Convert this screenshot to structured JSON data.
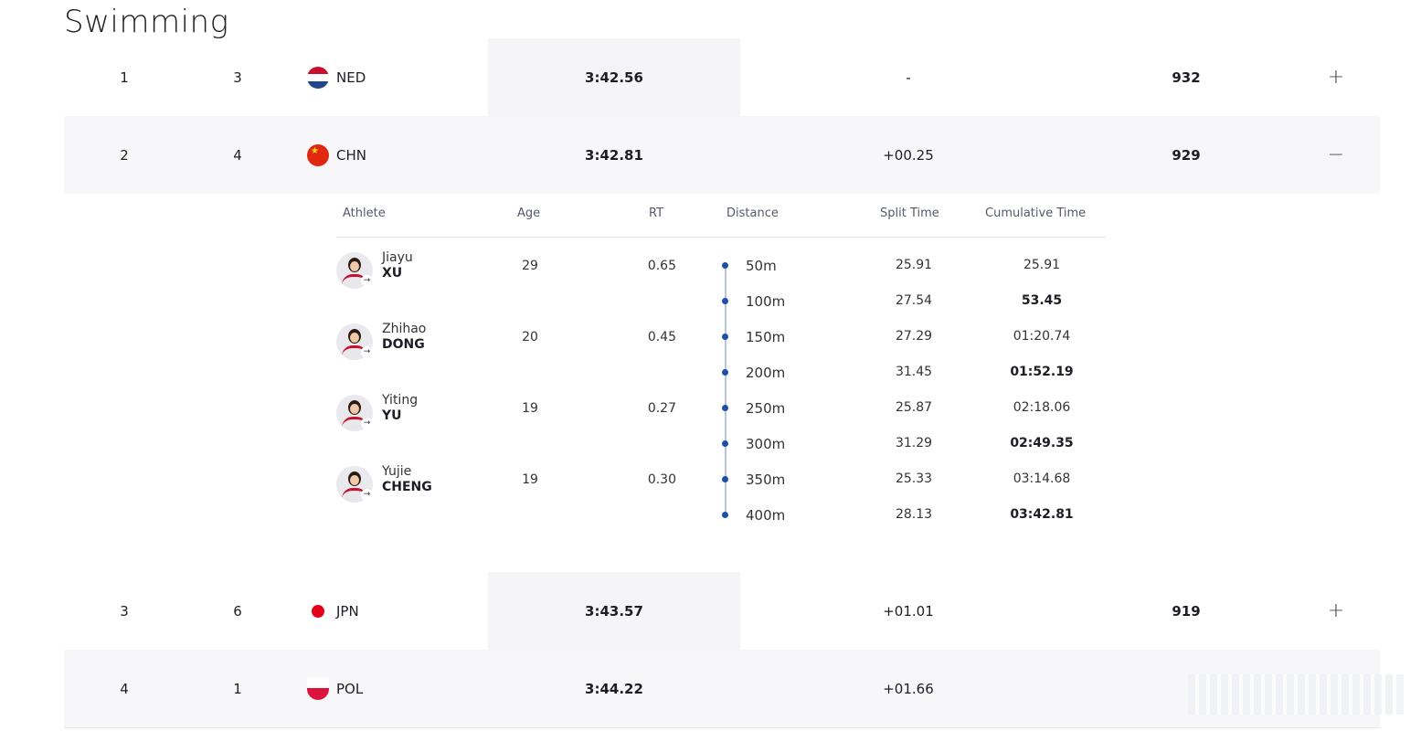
{
  "page": {
    "title": "Swimming"
  },
  "rows": [
    {
      "rank": "1",
      "lane": "3",
      "noc": "NED",
      "flag": "ned-flag-icon",
      "time": "3:42.56",
      "behind": "-",
      "points": "932",
      "toggle": "+"
    },
    {
      "rank": "2",
      "lane": "4",
      "noc": "CHN",
      "flag": "chn-flag-icon",
      "time": "3:42.81",
      "behind": "+00.25",
      "points": "929",
      "toggle": "−"
    },
    {
      "rank": "3",
      "lane": "6",
      "noc": "JPN",
      "flag": "jpn-flag-icon",
      "time": "3:43.57",
      "behind": "+01.01",
      "points": "919",
      "toggle": "+"
    },
    {
      "rank": "4",
      "lane": "1",
      "noc": "POL",
      "flag": "pol-flag-icon",
      "time": "3:44.22",
      "behind": "+01.66",
      "points": "",
      "toggle": ""
    }
  ],
  "detail": {
    "headers": {
      "athlete": "Athlete",
      "age": "Age",
      "rt": "RT",
      "distance": "Distance",
      "split": "Split Time",
      "cumulative": "Cumulative Time"
    },
    "athletes": [
      {
        "first": "Jiayu",
        "last": "XU",
        "age": "29",
        "rt": "0.65"
      },
      {
        "first": "Zhihao",
        "last": "DONG",
        "age": "20",
        "rt": "0.45"
      },
      {
        "first": "Yiting",
        "last": "YU",
        "age": "19",
        "rt": "0.27"
      },
      {
        "first": "Yujie",
        "last": "CHENG",
        "age": "19",
        "rt": "0.30"
      }
    ],
    "splits": [
      {
        "distance": "50m",
        "split": "25.91",
        "cumulative": "25.91",
        "bold": false
      },
      {
        "distance": "100m",
        "split": "27.54",
        "cumulative": "53.45",
        "bold": true
      },
      {
        "distance": "150m",
        "split": "27.29",
        "cumulative": "01:20.74",
        "bold": false
      },
      {
        "distance": "200m",
        "split": "31.45",
        "cumulative": "01:52.19",
        "bold": true
      },
      {
        "distance": "250m",
        "split": "25.87",
        "cumulative": "02:18.06",
        "bold": false
      },
      {
        "distance": "300m",
        "split": "31.29",
        "cumulative": "02:49.35",
        "bold": true
      },
      {
        "distance": "350m",
        "split": "25.33",
        "cumulative": "03:14.68",
        "bold": false
      },
      {
        "distance": "400m",
        "split": "28.13",
        "cumulative": "03:42.81",
        "bold": true
      }
    ]
  }
}
